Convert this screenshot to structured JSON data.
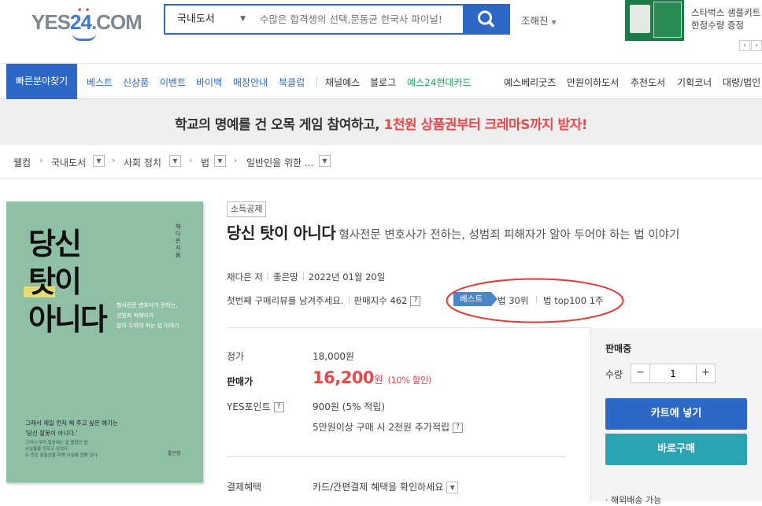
{
  "header": {
    "logo_text_a": "YES",
    "logo_text_num": "24",
    "logo_text_b": ".COM",
    "search_category": "국내도서",
    "search_placeholder": "수많은 합격생의 선택,문동균 한국사 파이널!",
    "user_name": "조해진",
    "promo_line1": "스타벅스 샘플키트",
    "promo_line2": "한정수량 증정",
    "promo_prev": "‹",
    "promo_next": "›"
  },
  "nav": {
    "quick": "빠른분야찾기",
    "items": [
      "베스트",
      "신상품",
      "이벤트",
      "바이백",
      "매장안내",
      "북클럽",
      "채널예스",
      "블로그",
      "예스24현대카드",
      "예스베리굿즈",
      "만원이하도서",
      "추천도서",
      "기획코너",
      "대량/법인"
    ]
  },
  "banner": {
    "text_a": "학교의 명예를 건 오목 게임 참여하고, ",
    "text_b": "1천원 상품권부터 크레마S까지 받자!"
  },
  "breadcrumb": [
    "웰컴",
    "국내도서",
    "사회 정치",
    "법",
    "일반인을 위한 ..."
  ],
  "cover": {
    "line1": "당신",
    "line2": "탓이",
    "line3": "아니다",
    "vertical": "채다은지음",
    "sub": "형사전문 변호사가 전하는,\n성범죄 피해자가\n알아 두어야 하는 법 이야기",
    "quote": "그래서 제일 먼저 해 주고 싶은 얘기는\n'당신 잘못이 아니다.'",
    "small": "그러나 우리 일상에는 잘 몰랐던 법\n사실들을 전하고 싶었다.\n두 번은 힘들었을 피해 사실에 접해 있다.",
    "publisher": "좋은땅"
  },
  "product": {
    "tax_badge": "소득공제",
    "title": "당신 탓이 아니다",
    "subtitle": "형사전문 변호사가 전하는, 성범죄 피해자가 알아 두어야 하는 법 이야기",
    "author": "채다은 저",
    "publisher": "좋은땅",
    "date": "2022년 01월 20일",
    "review_prompt": "첫번째 구매리뷰를 남겨주세요.",
    "sales_index": "판매지수 462",
    "best_tag": "베스트",
    "rank1": "법 30위",
    "rank2": "법 top100 1주",
    "list_price_label": "정가",
    "list_price": "18,000원",
    "sale_price_label": "판매가",
    "sale_price": "16,200",
    "sale_unit": "원",
    "discount": "(10% 할인)",
    "point_label": "YES포인트",
    "point_value": "900원 (5% 적립)",
    "extra_point": "5만원이상 구매 시 2천원 추가적립",
    "pay_label": "결제혜택",
    "pay_value": "카드/간편결제 혜택을 확인하세요",
    "q": "?"
  },
  "side": {
    "status": "판매중",
    "qty_label": "수량",
    "qty_value": "1",
    "minus": "−",
    "plus": "+",
    "cart_btn": "카트에 넣기",
    "buy_btn": "바로구매",
    "ship": "· 해외배송 가능"
  },
  "colors": {
    "brand_blue": "#2e68c6",
    "sale_red": "#e8494c",
    "buy_teal": "#2aa3b3",
    "annotation": "#e53935"
  }
}
